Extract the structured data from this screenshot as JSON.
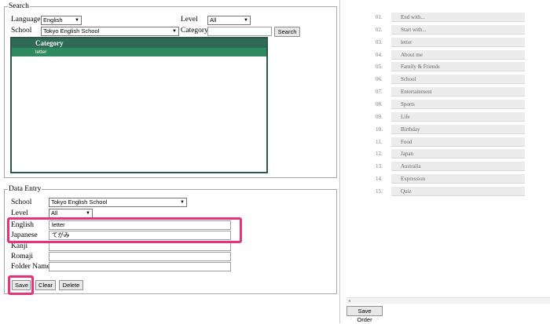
{
  "search": {
    "legend": "Search",
    "language_label": "Language",
    "language_value": "English",
    "level_label": "Level",
    "level_value": "All",
    "school_label": "School",
    "school_value": "Tokyo English School",
    "category_label": "Category",
    "category_value": "",
    "search_button": "Search",
    "grid": {
      "header": "Category",
      "rows": [
        "letter"
      ]
    }
  },
  "entry": {
    "legend": "Data Entry",
    "school_label": "School",
    "school_value": "Tokyo English School",
    "level_label": "Level",
    "level_value": "All",
    "english_label": "English",
    "english_value": "letter",
    "japanese_label": "Japanese",
    "japanese_value": "てがみ",
    "kanji_label": "Kanji",
    "kanji_value": "",
    "romaji_label": "Romaji",
    "romaji_value": "",
    "folder_label": "Folder Name",
    "folder_value": "",
    "save_button": "Save",
    "clear_button": "Clear",
    "delete_button": "Delete"
  },
  "order": {
    "items": [
      {
        "num": "01.",
        "label": "End with..."
      },
      {
        "num": "02.",
        "label": "Start with..."
      },
      {
        "num": "03.",
        "label": "letter"
      },
      {
        "num": "04.",
        "label": "About me"
      },
      {
        "num": "05.",
        "label": "Family & Friends"
      },
      {
        "num": "06.",
        "label": "School"
      },
      {
        "num": "07.",
        "label": "Entertainment"
      },
      {
        "num": "08.",
        "label": "Sports"
      },
      {
        "num": "09.",
        "label": "Life"
      },
      {
        "num": "10.",
        "label": "Birthday"
      },
      {
        "num": "11.",
        "label": "Food"
      },
      {
        "num": "12.",
        "label": "Japan"
      },
      {
        "num": "13.",
        "label": "Australia"
      },
      {
        "num": "14.",
        "label": "Expression"
      },
      {
        "num": "15.",
        "label": "Quiz"
      }
    ],
    "save_order_button": "Save Order",
    "scroll_arrow": "◂"
  },
  "colors": {
    "grid_header": "#2e6a55",
    "grid_row": "#2f8a5f",
    "highlight": "#e8337a"
  }
}
